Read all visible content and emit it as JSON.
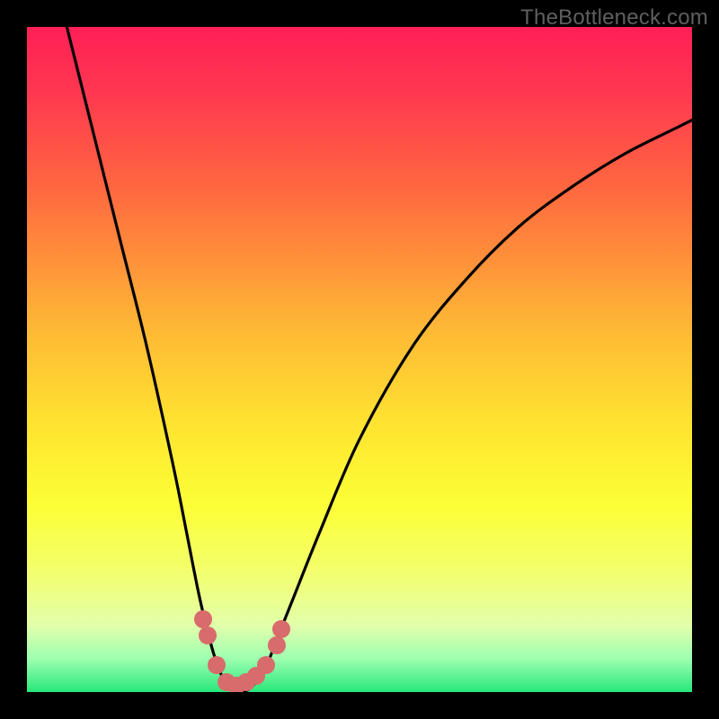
{
  "watermark": "TheBottleneck.com",
  "chart_data": {
    "type": "line",
    "title": "",
    "xlabel": "",
    "ylabel": "",
    "xlim": [
      0,
      100
    ],
    "ylim": [
      0,
      100
    ],
    "series": [
      {
        "name": "bottleneck-curve",
        "x": [
          6,
          10,
          14,
          18,
          22,
          24,
          26,
          28,
          29.5,
          31,
          32.5,
          34,
          36,
          38,
          40,
          44,
          50,
          58,
          66,
          74,
          82,
          90,
          98,
          100
        ],
        "y": [
          100,
          84,
          68,
          52,
          34,
          24,
          14,
          6,
          2,
          0,
          0,
          1,
          4,
          9,
          14,
          24,
          38,
          52,
          62,
          70,
          76,
          81,
          85,
          86
        ]
      }
    ],
    "markers": {
      "name": "bottleneck-points",
      "points": [
        {
          "x": 26.5,
          "y": 11
        },
        {
          "x": 27.2,
          "y": 8.5
        },
        {
          "x": 28.5,
          "y": 4
        },
        {
          "x": 30,
          "y": 1.5
        },
        {
          "x": 31.5,
          "y": 1
        },
        {
          "x": 33,
          "y": 1.5
        },
        {
          "x": 34.5,
          "y": 2.5
        },
        {
          "x": 36,
          "y": 4
        },
        {
          "x": 37.5,
          "y": 7
        },
        {
          "x": 38.2,
          "y": 9.5
        }
      ]
    },
    "gradient_stops": [
      {
        "pos": 0.0,
        "color": "#ff1f56"
      },
      {
        "pos": 0.1,
        "color": "#ff3850"
      },
      {
        "pos": 0.25,
        "color": "#ff6a3f"
      },
      {
        "pos": 0.45,
        "color": "#ffb735"
      },
      {
        "pos": 0.6,
        "color": "#ffe430"
      },
      {
        "pos": 0.72,
        "color": "#fcff36"
      },
      {
        "pos": 0.82,
        "color": "#f3ff6e"
      },
      {
        "pos": 0.9,
        "color": "#e2ffab"
      },
      {
        "pos": 0.95,
        "color": "#9dffb0"
      },
      {
        "pos": 1.0,
        "color": "#27e879"
      }
    ]
  }
}
